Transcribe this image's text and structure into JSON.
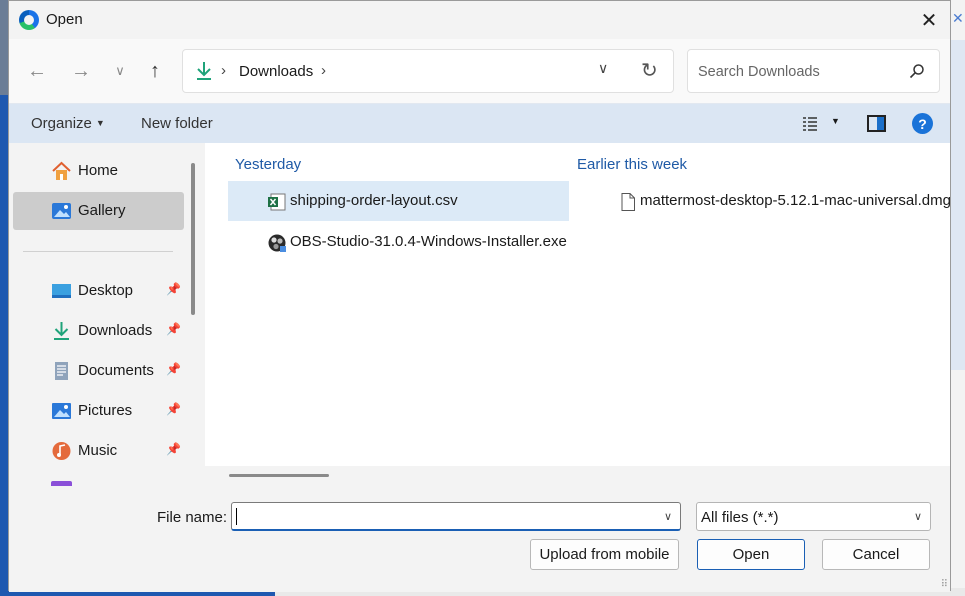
{
  "window": {
    "title": "Open"
  },
  "address": {
    "folder": "Downloads"
  },
  "search": {
    "placeholder": "Search Downloads"
  },
  "toolbar": {
    "organize_label": "Organize",
    "new_folder_label": "New folder"
  },
  "sidebar": {
    "items": [
      {
        "label": "Home",
        "icon": "home-icon"
      },
      {
        "label": "Gallery",
        "icon": "gallery-icon",
        "selected": true
      },
      {
        "label": "Desktop",
        "icon": "desktop-icon",
        "pinned": true
      },
      {
        "label": "Downloads",
        "icon": "download-icon",
        "pinned": true
      },
      {
        "label": "Documents",
        "icon": "documents-icon",
        "pinned": true
      },
      {
        "label": "Pictures",
        "icon": "pictures-icon",
        "pinned": true
      },
      {
        "label": "Music",
        "icon": "music-icon",
        "pinned": true
      }
    ]
  },
  "groups": [
    {
      "header": "Yesterday",
      "files": [
        {
          "name": "shipping-order-layout.csv",
          "icon": "excel-csv-icon",
          "selected": true
        },
        {
          "name": "OBS-Studio-31.0.4-Windows-Installer.exe",
          "icon": "obs-icon"
        }
      ]
    },
    {
      "header": "Earlier this week",
      "files": [
        {
          "name": "mattermost-desktop-5.12.1-mac-universal.dmg",
          "icon": "generic-file-icon"
        }
      ]
    }
  ],
  "footer": {
    "file_name_label": "File name:",
    "file_name_value": "",
    "file_type": "All files (*.*)",
    "upload_label": "Upload from mobile",
    "open_label": "Open",
    "cancel_label": "Cancel"
  },
  "colors": {
    "accent": "#1a5fb4",
    "toolbar_bg": "#dbe6f3",
    "selection": "#dceaf7",
    "group_header": "#1f5aa6"
  }
}
